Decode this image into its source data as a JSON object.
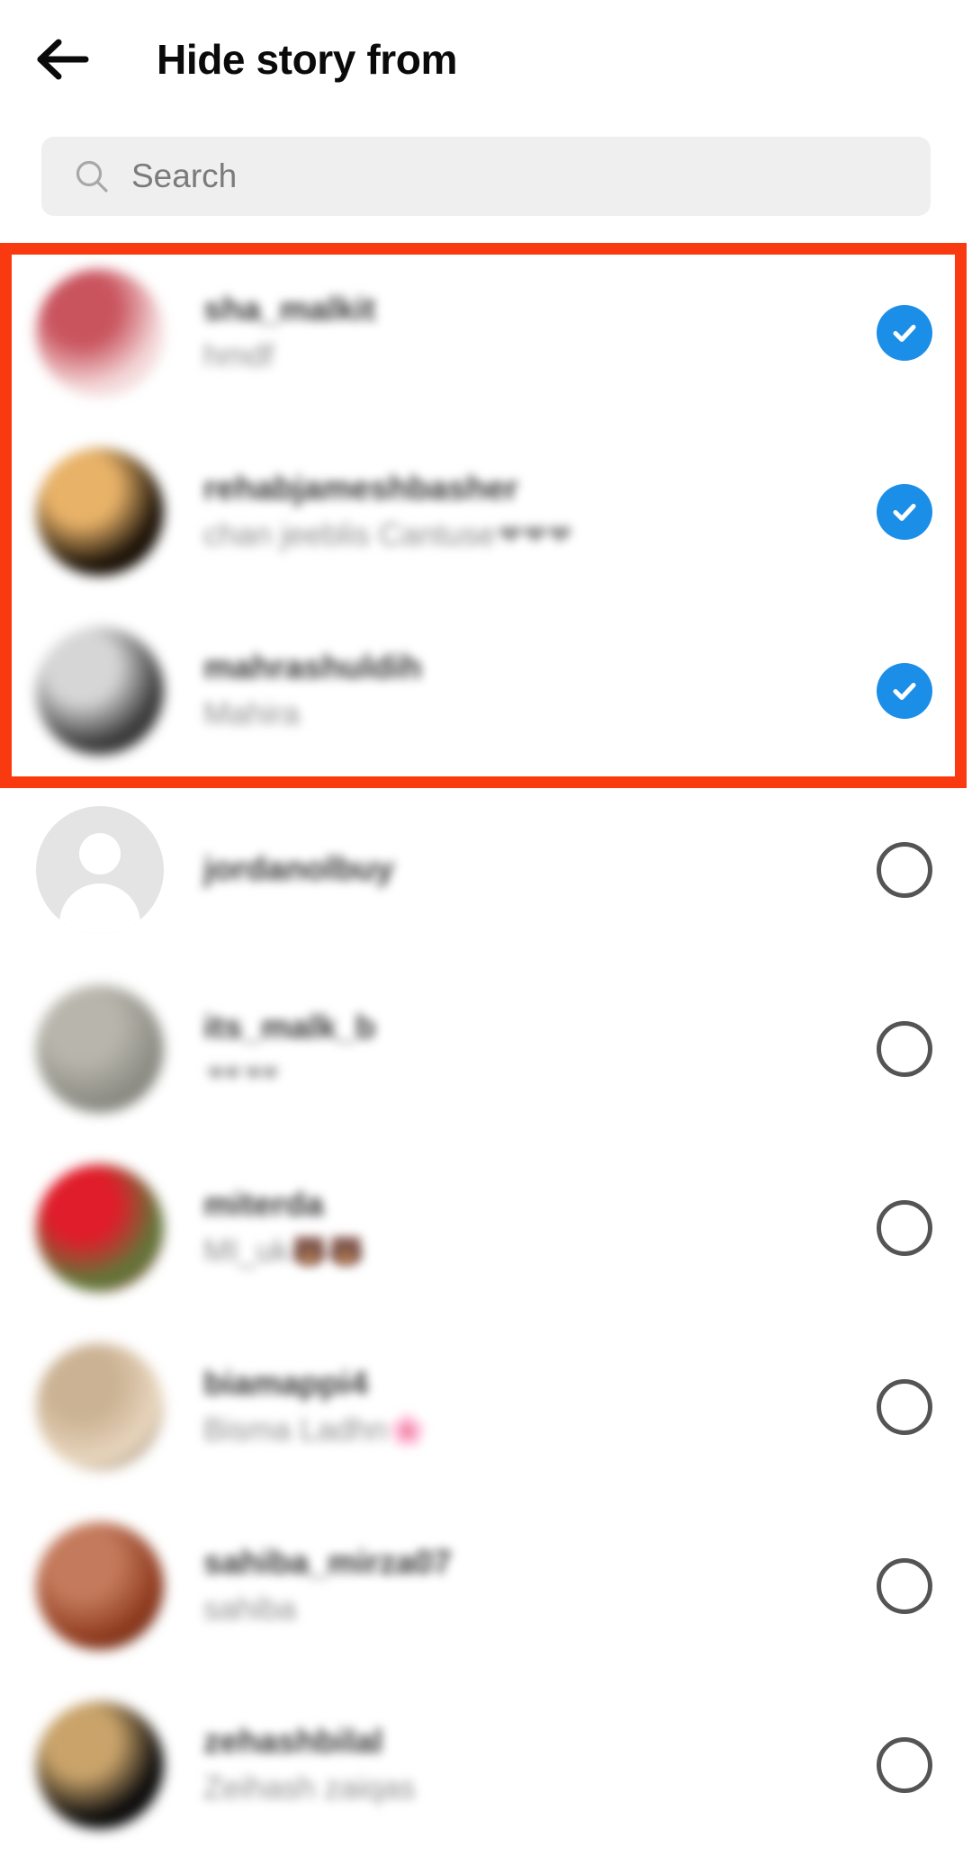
{
  "header": {
    "back_icon": "back-arrow-icon",
    "title": "Hide story from"
  },
  "search": {
    "icon": "search-icon",
    "placeholder": "Search",
    "value": ""
  },
  "highlight": {
    "color": "#f93a10",
    "label": "selected-users-highlight"
  },
  "colors": {
    "accent_checked": "#1b8ee8",
    "circle_outline": "#545454",
    "search_bg": "#efefef",
    "title": "#0a0a0a",
    "username": "#3a3a3a",
    "fullname": "#8e8e8e"
  },
  "list": {
    "rows": [
      {
        "username": "sha_malkit",
        "fullname": "hmdf",
        "fullname_emoji": "",
        "selected": true,
        "selected_icon": "check-circle-icon",
        "avatar_type": "photo",
        "avatar_colors": [
          "#f4d9da",
          "#c9545e",
          "#f7eceb"
        ]
      },
      {
        "username": "rehabjameshbasher",
        "fullname": "chan jeeblis Cantuse",
        "fullname_emoji": "❤❤❤",
        "selected": true,
        "selected_icon": "check-circle-icon",
        "avatar_type": "photo",
        "avatar_colors": [
          "#1b1208",
          "#e8b268",
          "#140f08"
        ]
      },
      {
        "username": "mahrashuldih",
        "fullname": "Mahira",
        "fullname_emoji": "",
        "selected": true,
        "selected_icon": "check-circle-icon",
        "avatar_type": "photo",
        "avatar_colors": [
          "#3b3b3b",
          "#d6d6d6",
          "#242424"
        ]
      },
      {
        "username": "jordanolbuy",
        "fullname": "",
        "fullname_emoji": "",
        "selected": false,
        "selected_icon": "empty-circle-icon",
        "avatar_type": "placeholder",
        "avatar_colors": [
          "#e4e4e4"
        ]
      },
      {
        "username": "its_malk_b",
        "fullname": "",
        "fullname_emoji": "🕶🕶",
        "selected": false,
        "selected_icon": "empty-circle-icon",
        "avatar_type": "photo",
        "avatar_colors": [
          "#8d8d85",
          "#b8b6ac",
          "#6d6d66"
        ]
      },
      {
        "username": "miterda",
        "fullname": "MI_uk",
        "fullname_emoji": "🐻🐻",
        "selected": false,
        "selected_icon": "empty-circle-icon",
        "avatar_type": "photo",
        "avatar_colors": [
          "#5d7a3a",
          "#e01d2a",
          "#b6152a"
        ]
      },
      {
        "username": "biamappi4",
        "fullname": "Bisma Ladhn",
        "fullname_emoji": "🌸",
        "selected": false,
        "selected_icon": "empty-circle-icon",
        "avatar_type": "photo",
        "avatar_colors": [
          "#e9d7bf",
          "#cbb294",
          "#3a2a1c"
        ]
      },
      {
        "username": "sahiba_mirza07",
        "fullname": "sahiba",
        "fullname_emoji": "",
        "selected": false,
        "selected_icon": "empty-circle-icon",
        "avatar_type": "photo",
        "avatar_colors": [
          "#8e3a1e",
          "#c47a5c",
          "#3a1a10"
        ]
      },
      {
        "username": "zehashbilal",
        "fullname": "Zeihash zaiqas",
        "fullname_emoji": "",
        "selected": false,
        "selected_icon": "empty-circle-icon",
        "avatar_type": "photo",
        "avatar_colors": [
          "#0b0b0b",
          "#c9a36a",
          "#141414"
        ]
      }
    ]
  }
}
